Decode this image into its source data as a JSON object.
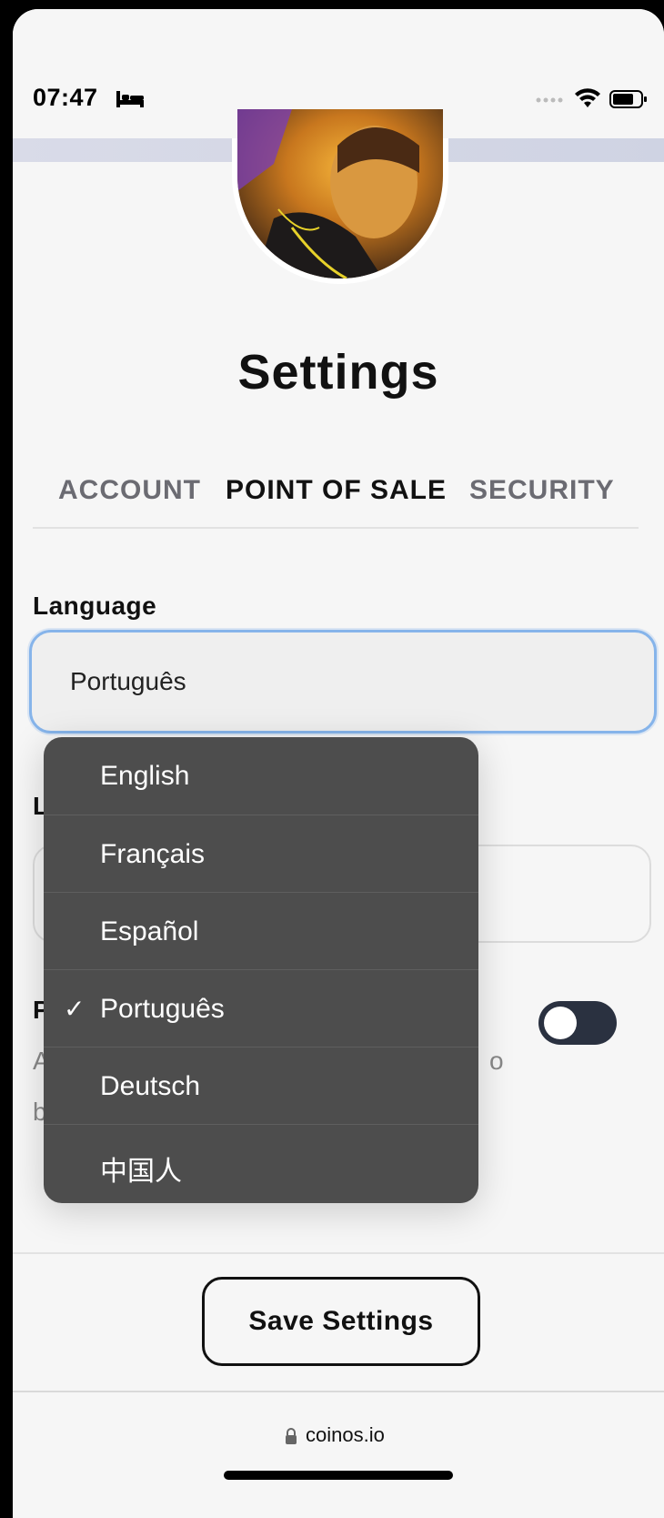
{
  "status_bar": {
    "time": "07:47"
  },
  "page": {
    "title": "Settings"
  },
  "tabs": [
    {
      "label": "ACCOUNT",
      "active": false
    },
    {
      "label": "POINT OF SALE",
      "active": true
    },
    {
      "label": "SECURITY",
      "active": false
    }
  ],
  "language": {
    "label": "Language",
    "selected": "Português"
  },
  "dropdown": {
    "options": [
      {
        "label": "English",
        "checked": false
      },
      {
        "label": "Français",
        "checked": false
      },
      {
        "label": "Español",
        "checked": false
      },
      {
        "label": "Português",
        "checked": true
      },
      {
        "label": "Deutsch",
        "checked": false
      },
      {
        "label": "中国人",
        "checked": false
      }
    ],
    "check_mark": "✓"
  },
  "obscured": {
    "label_fragment": "L",
    "row_label_fragment": "P",
    "desc_line1_fragment": "A",
    "desc_line2_fragment": "b",
    "desc_trailing_fragment": "o"
  },
  "toggle": {
    "on": false
  },
  "actions": {
    "save_label": "Save Settings"
  },
  "browser": {
    "url": "coinos.io"
  },
  "colors": {
    "accent_focus": "#86b4ea",
    "dropdown_bg": "#4d4d4d",
    "toggle_track": "#2a3140"
  }
}
